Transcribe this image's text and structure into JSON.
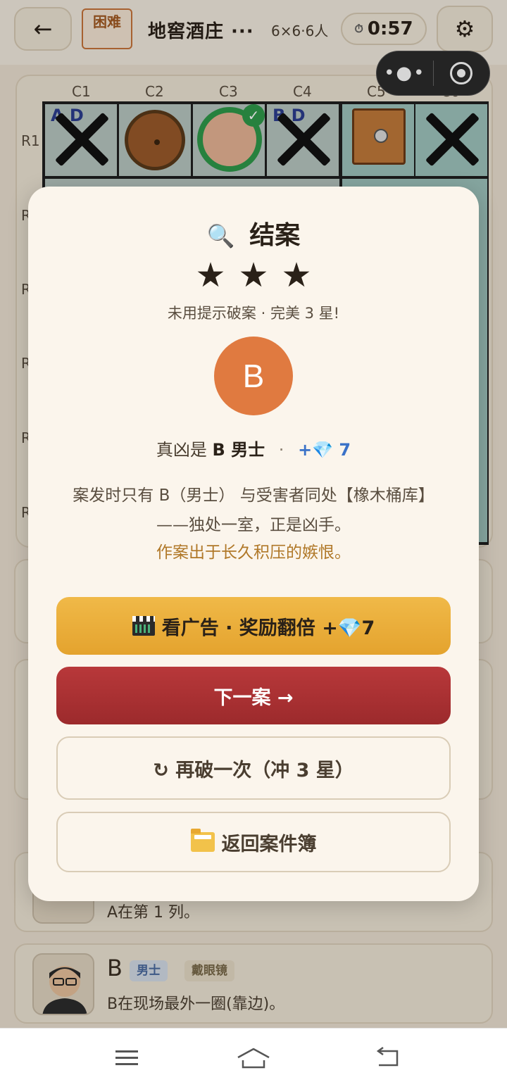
{
  "header": {
    "back_icon": "←",
    "difficulty": "困难",
    "level_title": "地窖酒庄 ···",
    "level_meta": "6×6·6人",
    "timer_icon": "⏱",
    "timer": "0:57",
    "settings_icon": "⚙"
  },
  "board": {
    "columns": [
      "C1",
      "C2",
      "C3",
      "C4",
      "C5",
      "C6"
    ],
    "rows": [
      "R1",
      "R",
      "R",
      "R",
      "R",
      "R"
    ],
    "cell_tags": {
      "c1": "A D",
      "c4": "B D"
    },
    "check": "✓"
  },
  "characters": [
    {
      "name": "A",
      "clue": "A在第 1 列。"
    },
    {
      "name": "B",
      "tags": [
        "男士",
        "戴眼镜"
      ],
      "clue": "B在现场最外一圈(靠边)。"
    }
  ],
  "modal": {
    "icon": "🔍",
    "title": "结案",
    "stars": "★★★",
    "subtitle": "未用提示破案 · 完美 3 星!",
    "culprit_initial": "B",
    "result_prefix": "真凶是",
    "result_name": "B 男士",
    "result_dot": "·",
    "result_reward": "+💎 7",
    "description": "案发时只有 B（男士） 与受害者同处【橡木桶库】——独处一室，正是凶手。",
    "motive": "作案出于长久积压的嫉恨。",
    "btn_ad": "看广告 · 奖励翻倍 +💎7",
    "btn_next": "下一案 →",
    "btn_retry": "↻ 再破一次（冲 3 星）",
    "btn_return": "返回案件簿"
  },
  "colors": {
    "accent_orange": "#e07a40",
    "primary_red": "#a83032",
    "ad_gold": "#eaaf3a",
    "gem_blue": "#3a72c8",
    "motive_brown": "#b07828"
  }
}
